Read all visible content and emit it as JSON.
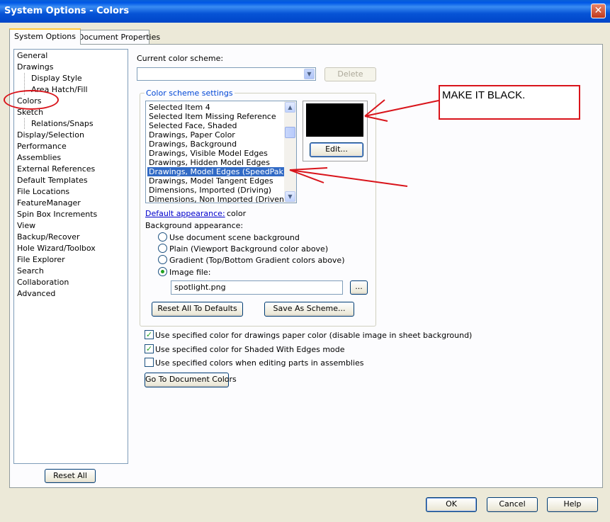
{
  "window": {
    "title": "System Options - Colors",
    "close_label": "✕"
  },
  "tabs": [
    {
      "label": "System Options",
      "active": true
    },
    {
      "label": "Document Properties",
      "active": false
    }
  ],
  "tree": {
    "items": [
      {
        "label": "General",
        "level": 0
      },
      {
        "label": "Drawings",
        "level": 0
      },
      {
        "label": "Display Style",
        "level": 1
      },
      {
        "label": "Area Hatch/Fill",
        "level": 1
      },
      {
        "label": "Colors",
        "level": 0
      },
      {
        "label": "Sketch",
        "level": 0
      },
      {
        "label": "Relations/Snaps",
        "level": 1
      },
      {
        "label": "Display/Selection",
        "level": 0
      },
      {
        "label": "Performance",
        "level": 0
      },
      {
        "label": "Assemblies",
        "level": 0
      },
      {
        "label": "External References",
        "level": 0
      },
      {
        "label": "Default Templates",
        "level": 0
      },
      {
        "label": "File Locations",
        "level": 0
      },
      {
        "label": "FeatureManager",
        "level": 0
      },
      {
        "label": "Spin Box Increments",
        "level": 0
      },
      {
        "label": "View",
        "level": 0
      },
      {
        "label": "Backup/Recover",
        "level": 0
      },
      {
        "label": "Hole Wizard/Toolbox",
        "level": 0
      },
      {
        "label": "File Explorer",
        "level": 0
      },
      {
        "label": "Search",
        "level": 0
      },
      {
        "label": "Collaboration",
        "level": 0
      },
      {
        "label": "Advanced",
        "level": 0
      }
    ],
    "reset_all_label": "Reset All"
  },
  "scheme": {
    "current_label": "Current color scheme:",
    "current_value": "",
    "delete_label": "Delete"
  },
  "settings": {
    "group_label": "Color scheme settings",
    "items": [
      "Selected Item 4",
      "Selected Item Missing Reference",
      "Selected Face, Shaded",
      "Drawings, Paper Color",
      "Drawings, Background",
      "Drawings, Visible Model Edges",
      "Drawings, Hidden Model Edges",
      "Drawings, Model Edges (SpeedPak)",
      "Drawings, Model Tangent Edges",
      "Dimensions, Imported (Driving)",
      "Dimensions, Non Imported (Driven)"
    ],
    "selected_index": 7,
    "swatch_color": "#000000",
    "edit_label": "Edit...",
    "default_appearance_link": "Default appearance:",
    "default_appearance_value": "color",
    "background_label": "Background appearance:",
    "background_options": [
      {
        "label": "Use document scene background",
        "checked": false
      },
      {
        "label": "Plain (Viewport Background color above)",
        "checked": false
      },
      {
        "label": "Gradient (Top/Bottom Gradient colors above)",
        "checked": false
      },
      {
        "label": "Image file:",
        "checked": true
      }
    ],
    "image_file": "spotlight.png",
    "browse_label": "...",
    "reset_defaults_label": "Reset All To Defaults",
    "save_scheme_label": "Save As Scheme..."
  },
  "checkboxes": [
    {
      "label": "Use specified color for drawings paper color (disable image in sheet background)",
      "checked": true
    },
    {
      "label": "Use specified color for Shaded With Edges mode",
      "checked": true
    },
    {
      "label": "Use specified colors when editing parts in assemblies",
      "checked": false
    }
  ],
  "check_mark": "✓",
  "goto_doc_colors_label": "Go To Document Colors",
  "footer": {
    "ok": "OK",
    "cancel": "Cancel",
    "help": "Help"
  },
  "annotation": {
    "text": "MAKE IT BLACK.",
    "color": "#d9141b"
  }
}
